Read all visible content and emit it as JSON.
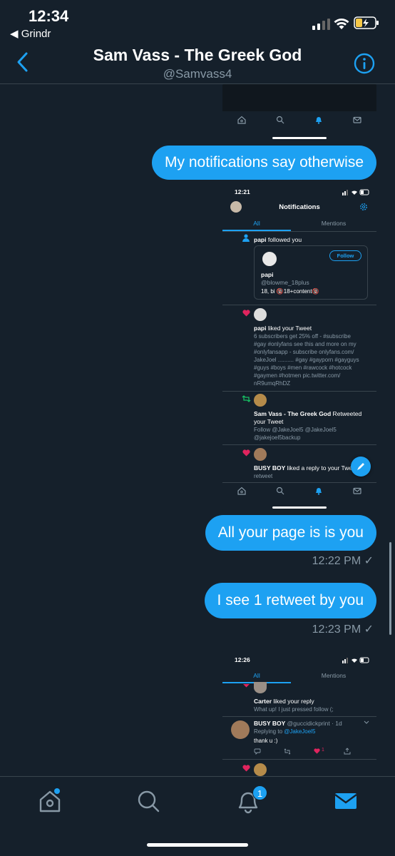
{
  "status_bar": {
    "time": "12:34",
    "back_app": "◀ Grindr"
  },
  "header": {
    "title": "Sam Vass - The Greek God",
    "handle": "@Samvass4"
  },
  "messages": [
    {
      "text": "My notifications say otherwise"
    },
    {
      "text": "All your page is is you",
      "time": "12:22 PM ✓"
    },
    {
      "text": "I see 1 retweet by you",
      "time": "12:23 PM ✓"
    }
  ],
  "shot1": {
    "time": "12:21",
    "title": "Notifications",
    "tab_all": "All",
    "tab_mentions": "Mentions",
    "follow_name": "papi",
    "follow_action": " followed you",
    "follow_button": "Follow",
    "card_name": "papi",
    "card_handle": "@blowme_18plus",
    "card_bio": "18, bi 🔞18+content🔞",
    "like_name": "papi",
    "like_action": " liked your Tweet",
    "like_text": [
      "6 subscribers get 25% off - #subscribe",
      "#gay #onlyfans see this and more on my",
      "#onlyfansapp - subscribe onlyfans.com/",
      "JakeJoel .......... #gay #gayporn #gayguys",
      "#guys #boys #men #rawcock #hotcock",
      "#gaymen #hotmen pic.twitter.com/",
      "nR9umqRhDZ"
    ],
    "rt_name": "Sam Vass - The Greek God",
    "rt_action": " Retweeted",
    "rt_action2": "your Tweet",
    "rt_text": [
      "Follow @JakeJoel5 @JakeJoel5",
      "@jakejoel5backup"
    ],
    "busy_name": "BUSY BOY",
    "busy_action": " liked a reply to your Tweet",
    "busy_text": "retweet"
  },
  "shot2": {
    "time": "12:26",
    "tab_all": "All",
    "tab_mentions": "Mentions",
    "carter_name": "Carter",
    "carter_action": " liked your reply",
    "carter_text": "What up! I just pressed follow (;",
    "busy_name": "BUSY BOY",
    "busy_handle": " @guccidickprint · 1d",
    "replying": "Replying to ",
    "replying_handle": "@JakeJoel5",
    "reply_text": "thank u :)",
    "like_count": "1"
  },
  "tabbar": {
    "notif_badge": "1"
  },
  "colors": {
    "accent": "#1da1f2",
    "bg": "#15202b",
    "heart": "#e0245e",
    "retweet": "#17bf63"
  }
}
